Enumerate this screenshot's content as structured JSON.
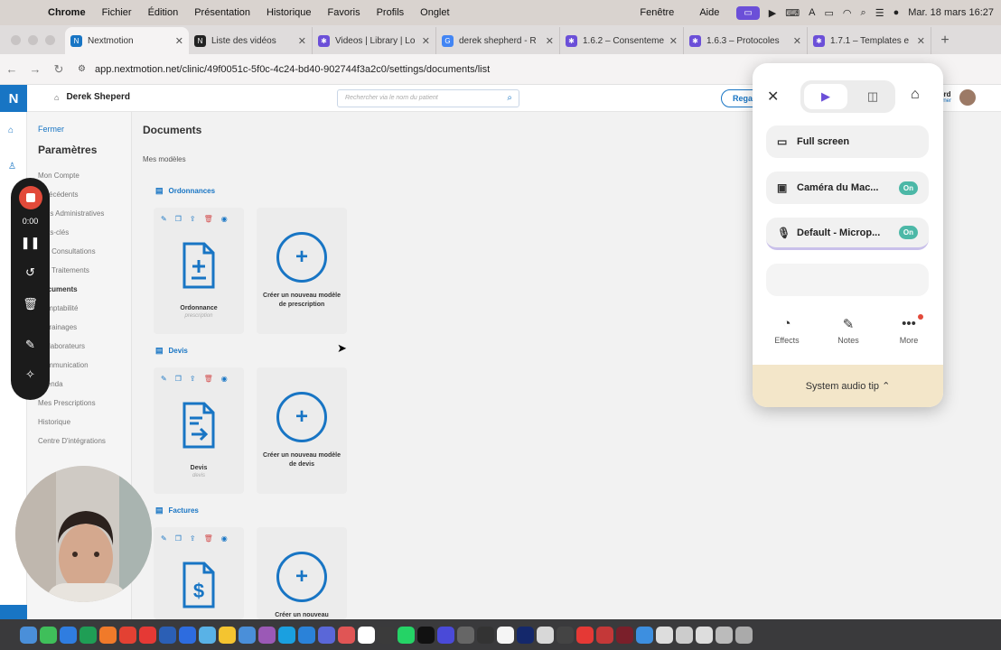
{
  "menubar": {
    "apple": "",
    "items": [
      "Chrome",
      "Fichier",
      "Édition",
      "Présentation",
      "Historique",
      "Favoris",
      "Profils",
      "Onglet"
    ],
    "right_items": [
      "Fenêtre",
      "Aide"
    ],
    "clock": "Mar. 18 mars  16:27"
  },
  "tabs": [
    {
      "title": "Nextmotion",
      "color": "#1875c4",
      "icon": "N"
    },
    {
      "title": "Liste des vidéos",
      "color": "#222222",
      "icon": "N"
    },
    {
      "title": "Videos | Library | Lo",
      "color": "#6b4fd8",
      "icon": "✱"
    },
    {
      "title": "derek shepherd - R",
      "color": "#4285f4",
      "icon": "G"
    },
    {
      "title": "1.6.2 – Consenteme",
      "color": "#6b4fd8",
      "icon": "✱"
    },
    {
      "title": "1.6.3 – Protocoles",
      "color": "#6b4fd8",
      "icon": "✱"
    },
    {
      "title": "1.7.1 – Templates e",
      "color": "#6b4fd8",
      "icon": "✱"
    }
  ],
  "url": "app.nextmotion.net/clinic/49f0051c-5f0c-4c24-bd40-902744f3a2c0/settings/documents/list",
  "app": {
    "logo": "N",
    "clinic_name": "Derek Sheperd",
    "search_placeholder": "Rechercher via le nom du patient",
    "regard_button": "Rega",
    "user_name": "erd",
    "user_role": "wner"
  },
  "sidebar": {
    "close": "Fermer",
    "title": "Paramètres",
    "items": [
      "Mon Compte",
      "Antécédents",
      "Infos Administratives",
      "Mots-clés",
      "Les Consultations",
      "Les Traitements",
      "Documents",
      "Comptabilité",
      "Parrainages",
      "Collaborateurs",
      "Communication",
      "Agenda",
      "Mes Prescriptions",
      "Historique",
      "Centre D'intégrations"
    ],
    "active_index": 6
  },
  "main": {
    "title": "Documents",
    "subtitle": "Mes modèles",
    "sections": [
      {
        "label": "Ordonnances",
        "card_name": "Ordonnance",
        "card_sub": "prescription",
        "create_text": "Créer un nouveau modèle de prescription"
      },
      {
        "label": "Devis",
        "card_name": "Devis",
        "card_sub": "devis",
        "create_text": "Créer un nouveau modèle de devis"
      },
      {
        "label": "Factures",
        "card_name": "",
        "card_sub": "",
        "create_text": "Créer un nouveau"
      }
    ]
  },
  "recorder": {
    "time": "0:00"
  },
  "loom_panel": {
    "full_screen": "Full screen",
    "camera": "Caméra du Mac...",
    "camera_state": "On",
    "microphone": "Default - Microp...",
    "microphone_state": "On",
    "effects": "Effects",
    "notes": "Notes",
    "more": "More",
    "tip": "System audio tip ⌃"
  },
  "dock_colors": [
    "#4a8fd9",
    "#3fbf5a",
    "#2f7de0",
    "#1f9e55",
    "#f07a2a",
    "#e34133",
    "#e53935",
    "#2b5fb5",
    "#2d6cdf",
    "#59b2e6",
    "#f4c430",
    "#4a8fd9",
    "#9b59b6",
    "#1aa0e0",
    "#2a82d9",
    "#5a67d8",
    "#e05555",
    "#ffffff",
    "#3b3b3b",
    "#25d366",
    "#111111",
    "#4a4ad8",
    "#666666",
    "#333333",
    "#f5f5f5",
    "#14286b",
    "#d8d8d8",
    "#444444",
    "#e53935",
    "#c43838",
    "#7a1f2a",
    "#3d8fe0",
    "#dddddd",
    "#cccccc",
    "#dddddd",
    "#bbbbbb",
    "#aaaaaa"
  ]
}
